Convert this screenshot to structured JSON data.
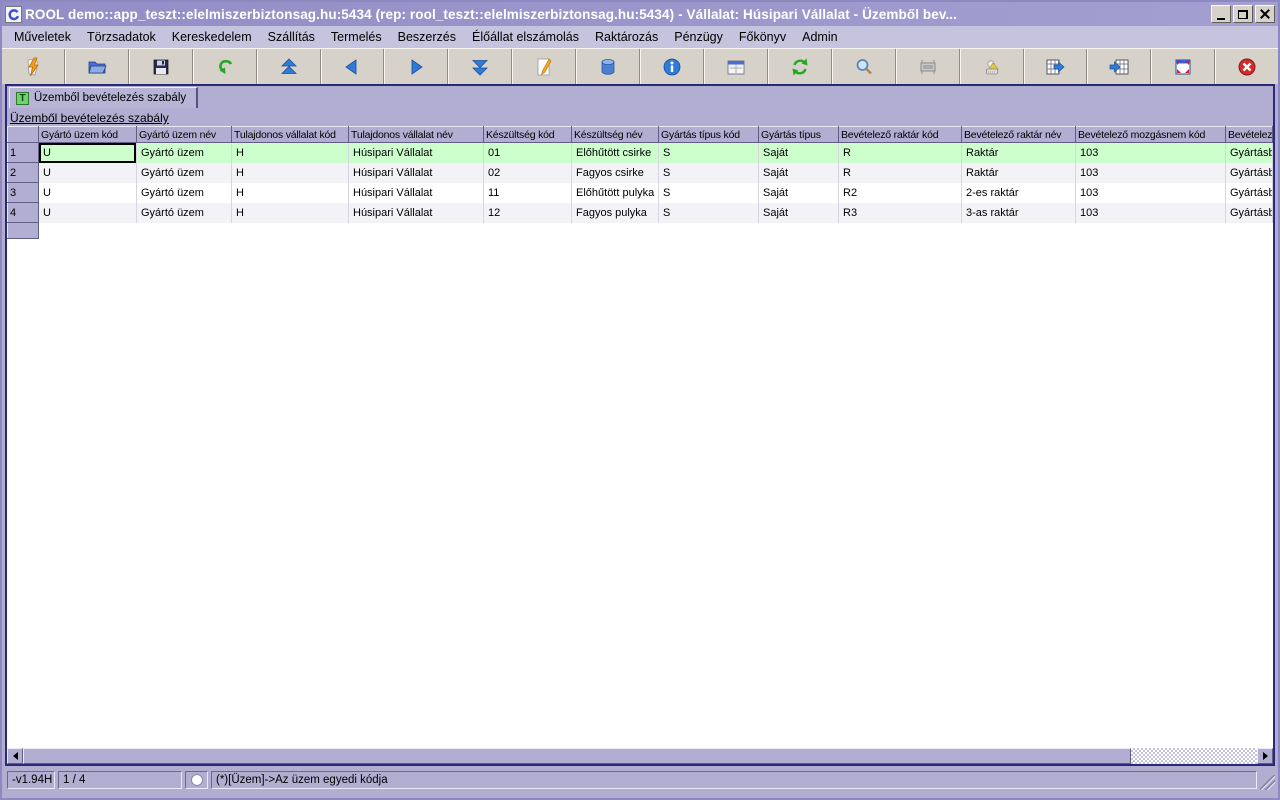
{
  "window": {
    "title": "ROOL demo::app_teszt::elelmiszerbiztonsag.hu:5434 (rep: rool_teszt::elelmiszerbiztonsag.hu:5434) - Vállalat: Húsipari Vállalat - Üzemből bev..."
  },
  "menu": {
    "items": [
      "Műveletek",
      "Törzsadatok",
      "Kereskedelem",
      "Szállítás",
      "Termelés",
      "Beszerzés",
      "Élőállat elszámolás",
      "Raktározás",
      "Pénzügy",
      "Főkönyv",
      "Admin"
    ]
  },
  "toolbar": {
    "buttons": [
      "run-query",
      "open",
      "save",
      "undo",
      "first-record",
      "prev-record",
      "next-record",
      "last-record",
      "edit",
      "database",
      "info",
      "form-view",
      "refresh",
      "search",
      "print-area",
      "plotter",
      "export-table",
      "import-table",
      "maximize-grid",
      "stop"
    ]
  },
  "tab": {
    "badge": "T",
    "label": "Üzemből bevételezés szabály"
  },
  "page": {
    "caption": "Üzemből bevételezés szabály"
  },
  "table": {
    "columns": [
      "Gyártó üzem kód",
      "Gyártó üzem név",
      "Tulajdonos vállalat kód",
      "Tulajdonos vállalat név",
      "Készültség kód",
      "Készültség név",
      "Gyártás típus kód",
      "Gyártás típus",
      "Bevételező raktár kód",
      "Bevételező raktár név",
      "Bevételező mozgásnem kód",
      "Bevételez"
    ],
    "row_numbers": [
      "1",
      "2",
      "3",
      "4"
    ],
    "rows": [
      [
        "U",
        "Gyártó üzem",
        "H",
        "Húsipari Vállalat",
        "01",
        "Előhűtött csirke",
        "S",
        "Saját",
        "R",
        "Raktár",
        "103",
        "Gyártásb"
      ],
      [
        "U",
        "Gyártó üzem",
        "H",
        "Húsipari Vállalat",
        "02",
        "Fagyos csirke",
        "S",
        "Saját",
        "R",
        "Raktár",
        "103",
        "Gyártásb"
      ],
      [
        "U",
        "Gyártó üzem",
        "H",
        "Húsipari Vállalat",
        "11",
        "Előhűtött pulyka",
        "S",
        "Saját",
        "R2",
        "2-es raktár",
        "103",
        "Gyártásb"
      ],
      [
        "U",
        "Gyártó üzem",
        "H",
        "Húsipari Vállalat",
        "12",
        "Fagyos pulyka",
        "S",
        "Saját",
        "R3",
        "3-as raktár",
        "103",
        "Gyártásb"
      ]
    ],
    "selected_row_index": 0
  },
  "status_bar": {
    "version": "-v1.94H",
    "record_position": "1 / 4",
    "message": "(*)[Üzem]->Az üzem egyedi kódja"
  },
  "colors": {
    "titlebar": "#9d99cb",
    "panel_lavender": "#b1aed2",
    "menubar": "#c6c3de",
    "toolbar_gray": "#d6d2ca",
    "selected_row_green": "#ccffcc",
    "client_border_navy": "#29297a"
  }
}
